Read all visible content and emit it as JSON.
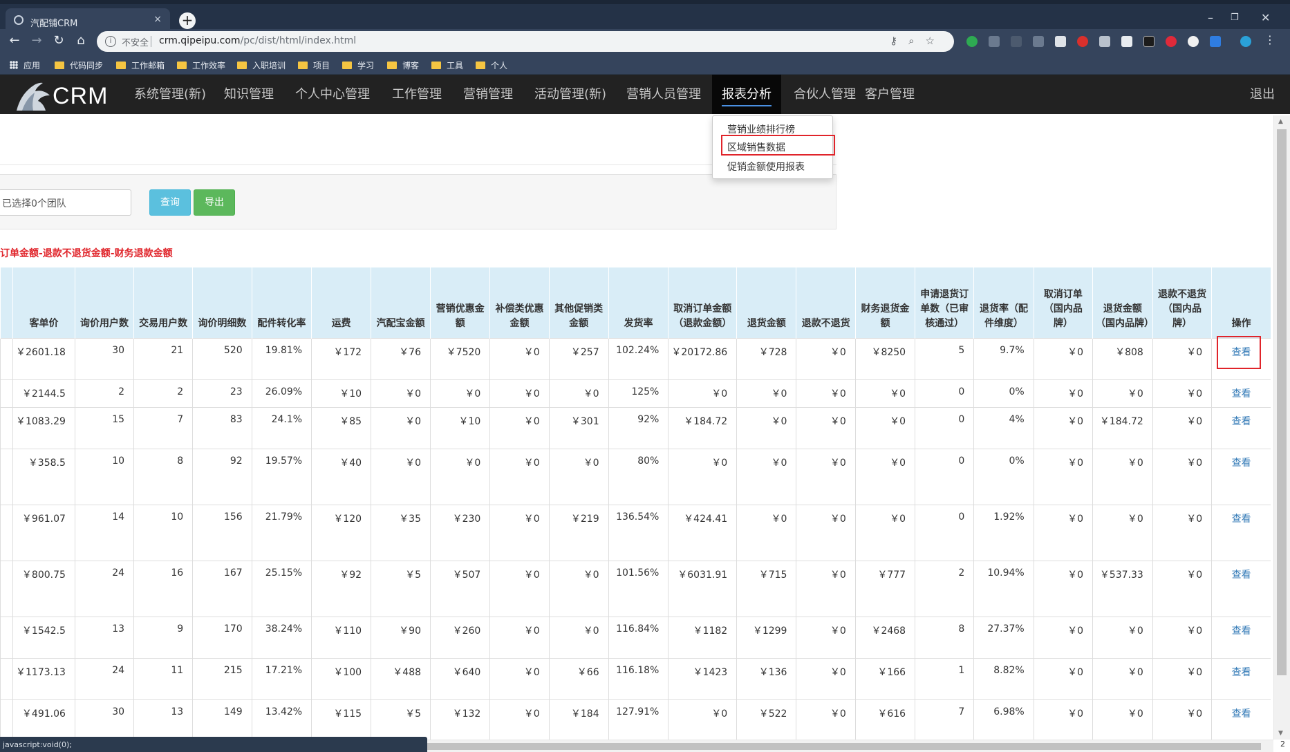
{
  "browser": {
    "tab_title": "汽配铺CRM",
    "tab_close": "×",
    "new_tab": "+",
    "win_min": "–",
    "win_max": "❐",
    "win_close": "✕",
    "insecure_label": "不安全",
    "url_host": "crm.qipeipu.com",
    "url_path": "/pc/dist/html/index.html",
    "status_text": "javascript:void(0);",
    "corner_text": "2"
  },
  "bookmarks": {
    "apps": "应用",
    "items": [
      "代码同步",
      "工作邮箱",
      "工作效率",
      "入职培训",
      "项目",
      "学习",
      "博客",
      "工具",
      "个人"
    ]
  },
  "app": {
    "logo_text": "CRM",
    "menu": [
      "系统管理(新)",
      "知识管理",
      "个人中心管理",
      "工作管理",
      "营销管理",
      "活动管理(新)",
      "营销人员管理",
      "报表分析",
      "合伙人管理",
      "客户管理"
    ],
    "active_menu": "报表分析",
    "logout": "退出",
    "dropdown": [
      "营销业绩排行榜",
      "区域销售数据",
      "促销金额使用报表"
    ]
  },
  "filters": {
    "team_select": "已选择0个团队",
    "query_button": "查询",
    "export_button": "导出"
  },
  "formula_note": "订单金额-退款不退货金额-财务退款金额",
  "table": {
    "headers": [
      "客单价",
      "询价用户数",
      "交易用户数",
      "询价明细数",
      "配件转化率",
      "运费",
      "汽配宝金额",
      "营销优惠金额",
      "补偿类优惠金额",
      "其他促销类金额",
      "发货率",
      "取消订单金额（退款金额）",
      "退货金额",
      "退款不退货",
      "财务退货金额",
      "申请退货订单数（已审核通过）",
      "退货率（配件维度）",
      "取消订单（国内品牌）",
      "退货金额（国内品牌）",
      "退款不退货（国内品牌）",
      "操作"
    ],
    "view_label": "查看",
    "rows": [
      [
        "￥2601.18",
        "30",
        "21",
        "520",
        "19.81%",
        "￥172",
        "￥76",
        "￥7520",
        "￥0",
        "￥257",
        "102.24%",
        "￥20172.86",
        "￥728",
        "￥0",
        "￥8250",
        "5",
        "9.7%",
        "￥0",
        "￥808",
        "￥0"
      ],
      [
        "￥2144.5",
        "2",
        "2",
        "23",
        "26.09%",
        "￥10",
        "￥0",
        "￥0",
        "￥0",
        "￥0",
        "125%",
        "￥0",
        "￥0",
        "￥0",
        "￥0",
        "0",
        "0%",
        "￥0",
        "￥0",
        "￥0"
      ],
      [
        "￥1083.29",
        "15",
        "7",
        "83",
        "24.1%",
        "￥85",
        "￥0",
        "￥10",
        "￥0",
        "￥301",
        "92%",
        "￥184.72",
        "￥0",
        "￥0",
        "￥0",
        "0",
        "4%",
        "￥0",
        "￥184.72",
        "￥0"
      ],
      [
        "￥358.5",
        "10",
        "8",
        "92",
        "19.57%",
        "￥40",
        "￥0",
        "￥0",
        "￥0",
        "￥0",
        "80%",
        "￥0",
        "￥0",
        "￥0",
        "￥0",
        "0",
        "0%",
        "￥0",
        "￥0",
        "￥0"
      ],
      [
        "￥961.07",
        "14",
        "10",
        "156",
        "21.79%",
        "￥120",
        "￥35",
        "￥230",
        "￥0",
        "￥219",
        "136.54%",
        "￥424.41",
        "￥0",
        "￥0",
        "￥0",
        "0",
        "1.92%",
        "￥0",
        "￥0",
        "￥0"
      ],
      [
        "￥800.75",
        "24",
        "16",
        "167",
        "25.15%",
        "￥92",
        "￥5",
        "￥507",
        "￥0",
        "￥0",
        "101.56%",
        "￥6031.91",
        "￥715",
        "￥0",
        "￥777",
        "2",
        "10.94%",
        "￥0",
        "￥537.33",
        "￥0"
      ],
      [
        "￥1542.5",
        "13",
        "9",
        "170",
        "38.24%",
        "￥110",
        "￥90",
        "￥260",
        "￥0",
        "￥0",
        "116.84%",
        "￥1182",
        "￥1299",
        "￥0",
        "￥2468",
        "8",
        "27.37%",
        "￥0",
        "￥0",
        "￥0"
      ],
      [
        "￥1173.13",
        "24",
        "11",
        "215",
        "17.21%",
        "￥100",
        "￥488",
        "￥640",
        "￥0",
        "￥66",
        "116.18%",
        "￥1423",
        "￥136",
        "￥0",
        "￥166",
        "1",
        "8.82%",
        "￥0",
        "￥0",
        "￥0"
      ],
      [
        "￥491.06",
        "30",
        "13",
        "149",
        "13.42%",
        "￥115",
        "￥5",
        "￥132",
        "￥0",
        "￥184",
        "127.91%",
        "￥0",
        "￥522",
        "￥0",
        "￥616",
        "7",
        "6.98%",
        "￥0",
        "￥0",
        "￥0"
      ]
    ]
  },
  "colors": {
    "nav_bg": "#222222",
    "header_bg": "#d9edf7",
    "highlight": "#e0242a",
    "link": "#337ab7",
    "query_btn": "#5bc0de",
    "export_btn": "#5cb85c"
  }
}
